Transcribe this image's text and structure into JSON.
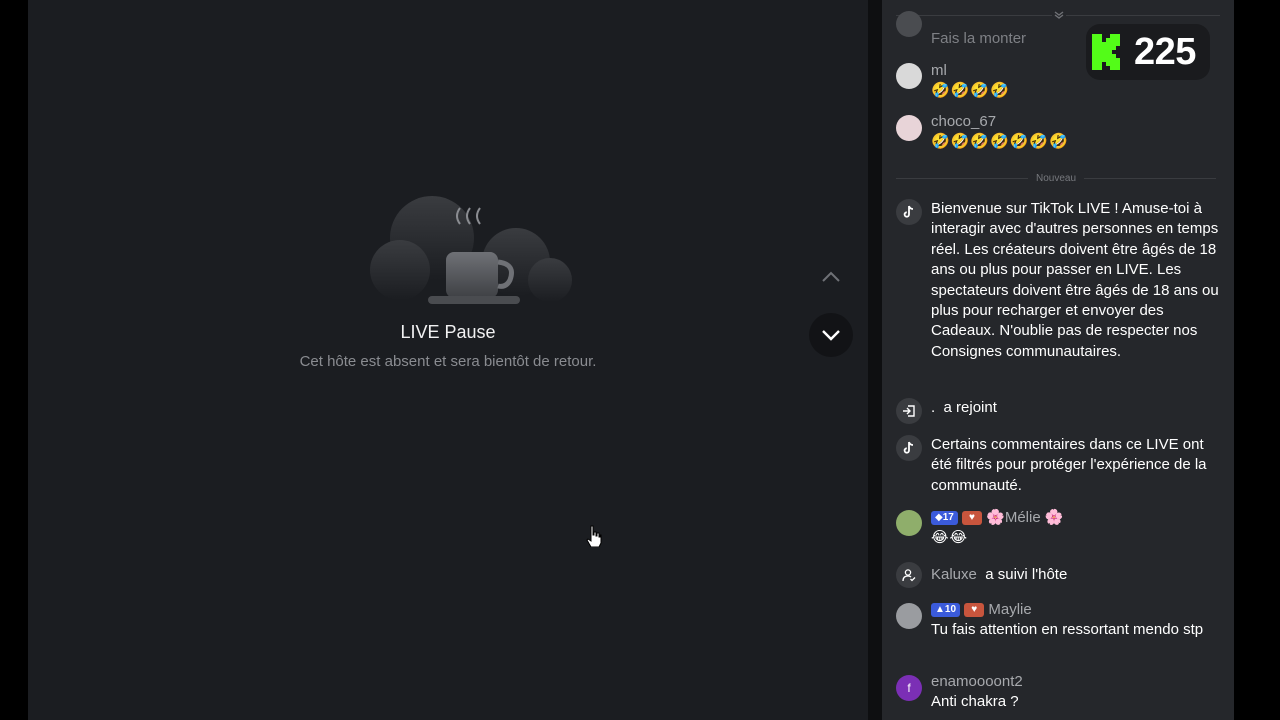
{
  "stage": {
    "pause_title": "LIVE Pause",
    "pause_subtitle": "Cet hôte est absent et sera bientôt de retour."
  },
  "viewer_count": "225",
  "chat": {
    "partial_top": "Fais la monter",
    "separator_label": "Nouveau",
    "messages": [
      {
        "user": "ml",
        "text": "🤣🤣🤣🤣"
      },
      {
        "user": "choco_67",
        "text": "🤣🤣🤣🤣🤣🤣🤣"
      }
    ],
    "welcome": "Bienvenue sur TikTok LIVE ! Amuse-toi à interagir avec d'autres personnes en temps réel. Les créateurs doivent être âgés de 18 ans ou plus pour passer en LIVE. Les spectateurs doivent être âgés de 18 ans ou plus pour recharger et envoyer des Cadeaux. N'oublie pas de respecter nos Consignes communautaires.",
    "joined": {
      "user": ".",
      "action": "a rejoint"
    },
    "filtered": "Certains commentaires dans ce LIVE ont été filtrés pour protéger l'expérience de la communauté.",
    "melie": {
      "level": "17",
      "user": "🌸Mélie 🌸",
      "text": "😂😂"
    },
    "follow": {
      "user": "Kaluxe",
      "action": "a suivi l'hôte"
    },
    "maylie": {
      "level": "10",
      "user": "Maylie",
      "text": "Tu fais attention en ressortant mendo stp"
    },
    "enamo": {
      "avatar_letter": "f",
      "user": "enamoooont2",
      "text": "Anti chakra ?"
    }
  },
  "colors": {
    "chat_bg": "#25272b",
    "stage_bg": "#1b1d21",
    "brand_green": "#53fc18",
    "level_badge": "#3b5bdb"
  },
  "icons": [
    "coffee-cup-icon",
    "chevron-up-icon",
    "chevron-down-icon",
    "tiktok-icon",
    "enter-icon",
    "follow-icon",
    "hand-cursor-icon",
    "kick-logo-icon"
  ]
}
